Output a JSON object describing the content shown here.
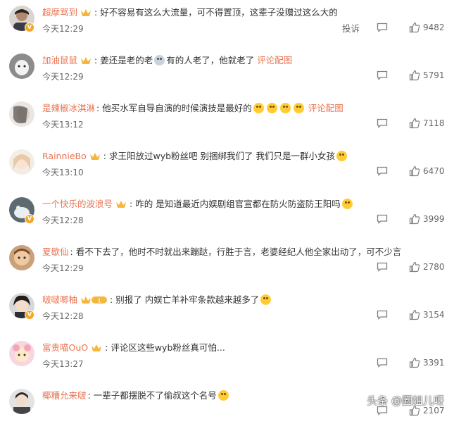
{
  "colors": {
    "username": "#eb7350",
    "text": "#333333",
    "meta": "#666666"
  },
  "comments": [
    {
      "username": "超摩骂到",
      "text_a": "好不容易有这么大流量，可不得置顶，这辈子没赠过这么大的",
      "text_b": "",
      "link": "",
      "time": "今天12:29",
      "report": "投诉",
      "likes": "9482",
      "crown": true
    },
    {
      "username": "加油鼠鼠",
      "text_a": "姜还是老的老",
      "text_b": "有的人老了，他就老了",
      "link": "评论配图",
      "time": "今天12:29",
      "report": "",
      "likes": "5791",
      "crown": true
    },
    {
      "username": "是辣椒冰淇淋",
      "text_a": "他买水军自导自演的时候演技是最好的",
      "text_b": "",
      "link": "评论配图",
      "time": "今天13:12",
      "report": "",
      "likes": "7118",
      "crown": false
    },
    {
      "username": "RainnieBo",
      "text_a": "求王阳放过wyb粉丝吧 别捆绑我们了 我们只是一群小女孩",
      "text_b": "",
      "link": "",
      "time": "今天13:10",
      "report": "",
      "likes": "6470",
      "crown": true
    },
    {
      "username": "一个快乐的波浪号",
      "text_a": "咋的 是知道最近内娱剧组官宣都在防火防盗防王阳吗",
      "text_b": "",
      "link": "",
      "time": "今天12:28",
      "report": "",
      "likes": "3999",
      "crown": true
    },
    {
      "username": "夏歇仙",
      "text_a": "看不下去了，他时不时就出来蹦跶，行胜于言，老婆经纪人他全家出动了，可不少言",
      "text_b": "",
      "link": "",
      "time": "今天12:29",
      "report": "",
      "likes": "2780",
      "crown": false
    },
    {
      "username": "啵啵唧柚",
      "text_a": "别报了 内娱亡羊补牢条款越来越多了",
      "text_b": "",
      "link": "",
      "time": "今天12:28",
      "report": "",
      "likes": "3154",
      "crown": false,
      "level": "1"
    },
    {
      "username": "富贵喵OuO",
      "text_a": "评论区这些wyb粉丝真可怕...",
      "text_b": "",
      "link": "",
      "time": "今天13:27",
      "report": "",
      "likes": "3391",
      "crown": true
    },
    {
      "username": "椰糟允来啵",
      "text_a": "一辈子都摆脱不了偷叔这个名号",
      "text_b": "",
      "link": "",
      "time": "",
      "report": "",
      "likes": "2107",
      "crown": false
    }
  ],
  "watermark": "头条 @圈姐儿呀"
}
